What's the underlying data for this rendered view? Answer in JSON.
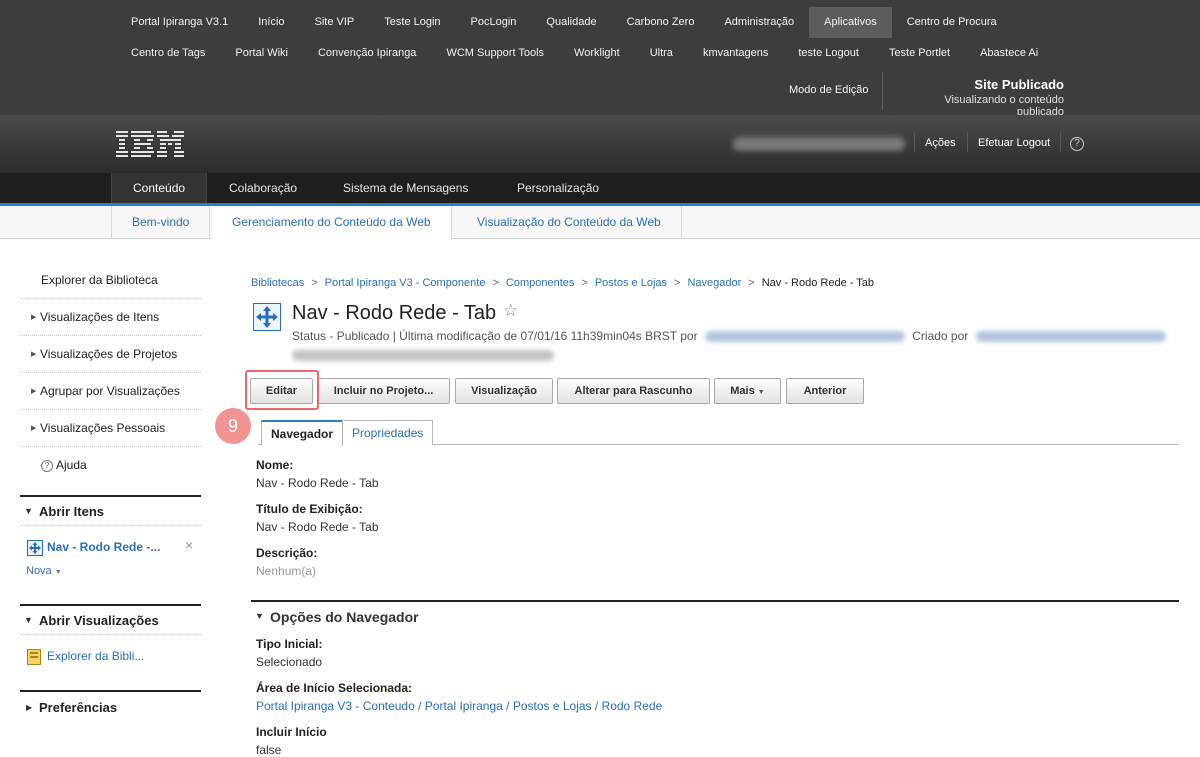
{
  "top_nav": {
    "row1": [
      "Portal Ipiranga V3.1",
      "Início",
      "Site VIP",
      "Teste Login",
      "PocLogin",
      "Qualidade",
      "Carbono Zero",
      "Administração",
      "Aplicativos",
      "Centro de Procura"
    ],
    "row2": [
      "Centro de Tags",
      "Portal Wiki",
      "Convenção Ipiranga",
      "WCM Support Tools",
      "Worklight",
      "Ultra",
      "kmvantagens",
      "teste Logout",
      "Teste Portlet",
      "Abastece Ai"
    ],
    "active": "Aplicativos",
    "edit_mode": "Modo de Edição",
    "site_status_title": "Site Publicado",
    "site_status_sub": "Visualizando o conteúdo publicado"
  },
  "banner": {
    "logo": "IBM",
    "actions_label": "Ações",
    "logout_label": "Efetuar Logout",
    "help_icon": "?"
  },
  "main_nav": {
    "items": [
      "Conteúdo",
      "Colaboração",
      "Sistema de Mensagens",
      "Personalização"
    ],
    "active": "Conteúdo"
  },
  "sub_nav": {
    "items": [
      "Bem-vindo",
      "Gerenciamento do Conteúdo da Web",
      "Visualização do Conteúdo da Web"
    ],
    "active": "Gerenciamento do Conteúdo da Web"
  },
  "sidebar": {
    "title": "Explorer da Biblioteca",
    "items": [
      "Visualizações de Itens",
      "Visualizações de Projetos",
      "Agrupar por Visualizações",
      "Visualizações Pessoais"
    ],
    "help_label": "Ajuda",
    "open_items": {
      "header": "Abrir Itens",
      "item_label": "Nav - Rodo Rede -...",
      "new_label": "Nova"
    },
    "open_views": {
      "header": "Abrir Visualizações",
      "item_label": "Explorer da Bibli..."
    },
    "preferences": {
      "header": "Preferências"
    }
  },
  "breadcrumb": [
    "Bibliotecas",
    "Portal Ipiranga V3 - Componente",
    "Componentes",
    "Postos e Lojas",
    "Navegador",
    "Nav - Rodo Rede - Tab"
  ],
  "item": {
    "title": "Nav - Rodo Rede - Tab",
    "status_text": "Status - Publicado | Última modificação de 07/01/16 11h39min04s BRST por",
    "created_by_label": "Criado por"
  },
  "toolbar": {
    "buttons": [
      "Editar",
      "Incluir no Projeto...",
      "Visualização",
      "Alterar para Rascunho",
      "Mais",
      "Anterior"
    ]
  },
  "annotation": {
    "step": "9"
  },
  "tabs": [
    "Navegador",
    "Propriedades"
  ],
  "fields": {
    "name_label": "Nome:",
    "name_value": "Nav - Rodo Rede - Tab",
    "display_title_label": "Título de Exibição:",
    "display_title_value": "Nav - Rodo Rede - Tab",
    "description_label": "Descrição:",
    "description_value": "Nenhum(a)"
  },
  "navigator_options": {
    "header": "Opções do Navegador",
    "start_type_label": "Tipo Inicial:",
    "start_type_value": "Selecionado",
    "selected_area_label": "Área de Início Selecionada:",
    "selected_area_value": "Portal Ipiranga V3 - Conteudo / Portal Ipiranga / Postos e Lojas / Rodo Rede",
    "include_start_label": "Incluir Início",
    "include_start_value": "false"
  },
  "colors": {
    "accent": "#2d7fc1",
    "link": "#2a6ebb",
    "annotation": "#f29494"
  }
}
